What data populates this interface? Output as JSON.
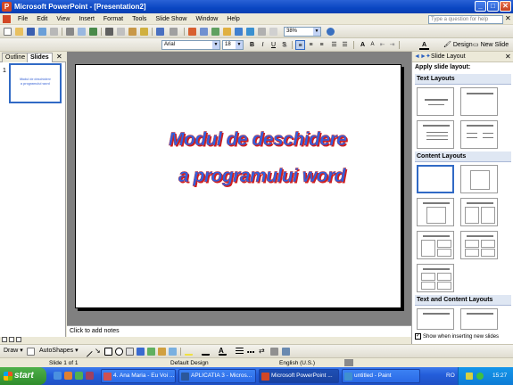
{
  "window": {
    "title": "Microsoft PowerPoint - [Presentation2]",
    "app_icon": "P",
    "min": "_",
    "max": "□",
    "close": "✕"
  },
  "menu": {
    "items": [
      "File",
      "Edit",
      "View",
      "Insert",
      "Format",
      "Tools",
      "Slide Show",
      "Window",
      "Help"
    ],
    "help_placeholder": "Type a question for help",
    "close": "✕"
  },
  "toolbar1": {
    "zoom": "38%",
    "font": "Arial",
    "size": "18"
  },
  "toolbar2": {
    "bold": "B",
    "italic": "I",
    "underline": "U",
    "shadow": "S",
    "font_color": "A",
    "design": "Design",
    "new_slide": "New Slide"
  },
  "left_panel": {
    "tab_outline": "Outline",
    "tab_slides": "Slides",
    "close": "✕",
    "slide_number": "1",
    "thumb_line1": "Modul de deschidere",
    "thumb_line2": "a programului word"
  },
  "slide": {
    "line1": "Modul de deschidere",
    "line2": "a programului word"
  },
  "notes": {
    "placeholder": "Click to add notes"
  },
  "task_pane": {
    "title": "Slide Layout",
    "back": "◄",
    "forward": "►",
    "home": "✦",
    "close": "✕",
    "apply_label": "Apply slide layout:",
    "sections": [
      "Text Layouts",
      "Content Layouts",
      "Text and Content Layouts"
    ],
    "show_when_inserting": "Show when inserting new slides",
    "checkbox_checked": "✓"
  },
  "drawing_toolbar": {
    "draw": "Draw",
    "autoshapes": "AutoShapes"
  },
  "status": {
    "slide": "Slide 1 of 1",
    "design": "Default Design",
    "language": "English (U.S.)"
  },
  "taskbar": {
    "start": "start",
    "buttons": [
      "4. Ana Maria - Eu Voi ...",
      "APLICATIA 3 - Micros...",
      "Microsoft PowerPoint ...",
      "untitled - Paint"
    ],
    "lang": "RO",
    "clock": "15:27"
  },
  "colors": {
    "title_bar": "#0a46c2",
    "slide_text": "#3060e0",
    "slide_text_shadow": "#d02020",
    "taskbar": "#245edb"
  }
}
